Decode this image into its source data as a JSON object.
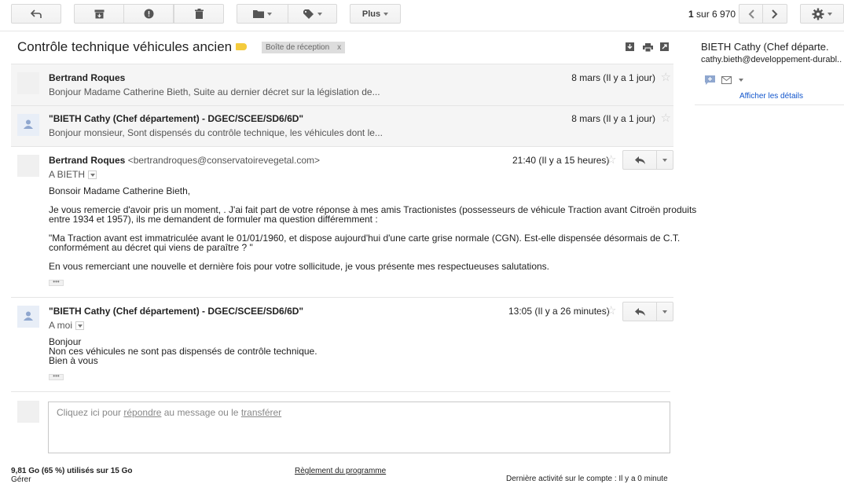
{
  "toolbar": {
    "more_label": "Plus",
    "counter_bold": "1",
    "counter_rest": " sur 6 970"
  },
  "subject": "Contrôle technique véhicules ancien",
  "label": {
    "name": "Boîte de réception",
    "remove": "x"
  },
  "messages_collapsed": [
    {
      "sender": "Bertrand Roques",
      "snippet": "Bonjour Madame Catherine Bieth, Suite au dernier décret sur la législation de...",
      "date": "8 mars (Il y a 1 jour)"
    },
    {
      "sender": "\"BIETH Cathy (Chef département) - DGEC/SCEE/SD6/6D\"",
      "snippet": "Bonjour monsieur, Sont dispensés du contrôle technique, les véhicules dont le...",
      "date": "8 mars (Il y a 1 jour)"
    }
  ],
  "message1": {
    "sender": "Bertrand Roques",
    "email": " <bertrandroques@conservatoirevegetal.com>",
    "date": "21:40 (Il y a 15 heures)",
    "to": "A BIETH",
    "lines": [
      "Bonsoir Madame Catherine Bieth,",
      "Je vous remercie d'avoir pris un moment, . J'ai fait part de votre réponse à mes amis Tractionistes (possesseurs de véhicule Traction avant Citroën produits",
      "entre 1934 et 1957), ils me demandent de formuler ma question différemment :",
      "\"Ma Traction avant est immatriculée avant le 01/01/1960,  et dispose aujourd'hui d'une carte grise normale (CGN). Est-elle dispensée désormais de C.T.",
      "conformément au décret qui viens de paraître ? \"",
      "En vous remerciant une nouvelle et dernière fois pour votre sollicitude, je vous présente mes respectueuses salutations."
    ],
    "ellipsis": "•••"
  },
  "message2": {
    "sender": "\"BIETH Cathy (Chef département) - DGEC/SCEE/SD6/6D\"",
    "date": "13:05 (Il y a 26 minutes)",
    "to": "A moi",
    "lines": [
      "Bonjour",
      "Non ces véhicules ne sont pas dispensés de contrôle technique.",
      "Bien à vous"
    ],
    "ellipsis": "•••"
  },
  "reply": {
    "prefix": "Cliquez ici pour ",
    "reply_link": "répondre",
    "middle": " au message ou le ",
    "forward_link": "transférer"
  },
  "footer": {
    "storage": "9,81 Go (65 %) utilisés sur 15 Go",
    "manage": "Gérer",
    "program": "Règlement du programme",
    "activity": "Dernière activité sur le compte : Il y a 0 minute"
  },
  "sidebar": {
    "name": "BIETH Cathy (Chef départe.",
    "email": "cathy.bieth@developpement-durabl..",
    "details_link": "Afficher les détails"
  },
  "colors": {
    "accent": "#15c",
    "label_yellow": "#f4cb3d"
  }
}
